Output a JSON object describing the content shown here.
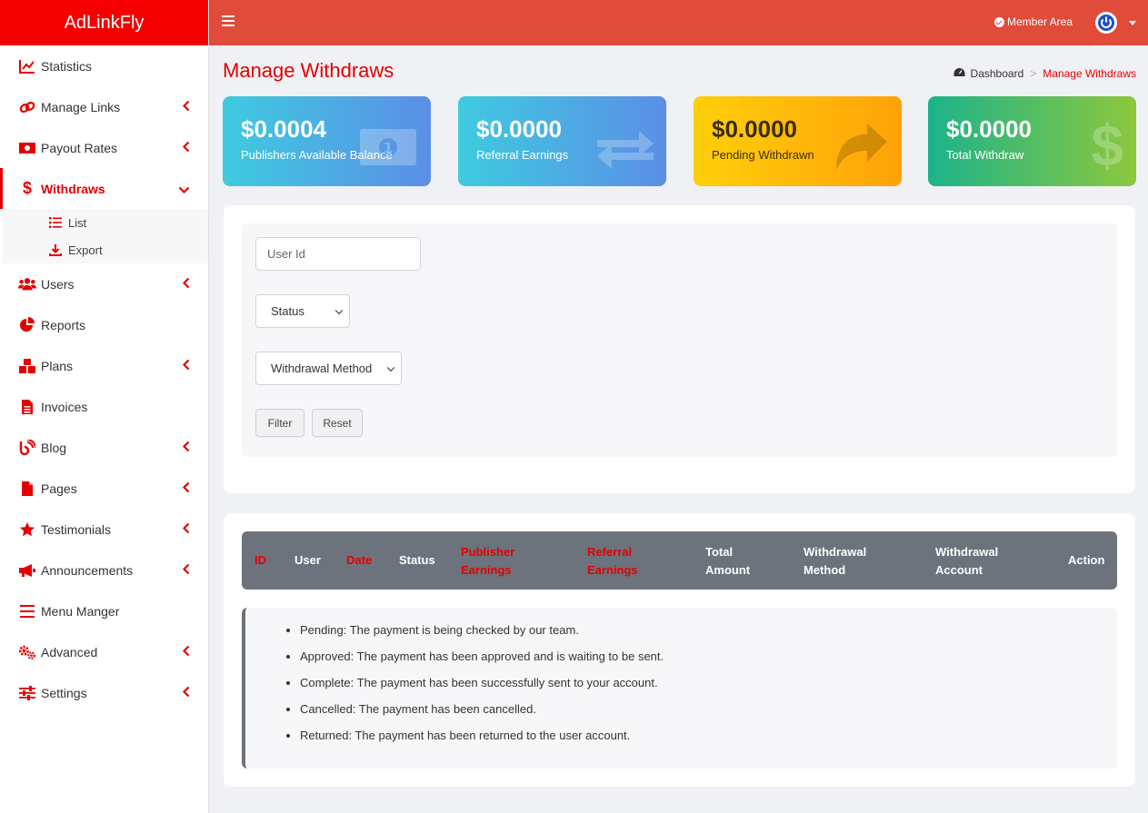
{
  "app": {
    "brand": "AdLinkFly"
  },
  "header": {
    "member_area": "Member Area"
  },
  "sidebar": {
    "items": [
      {
        "label": "Statistics",
        "icon": "chart-line-icon"
      },
      {
        "label": "Manage Links",
        "icon": "link-icon"
      },
      {
        "label": "Payout Rates",
        "icon": "money-bill-icon"
      },
      {
        "label": "Withdraws",
        "icon": "dollar-sign-icon"
      },
      {
        "label": "Users",
        "icon": "users-icon"
      },
      {
        "label": "Reports",
        "icon": "pie-chart-icon"
      },
      {
        "label": "Plans",
        "icon": "cubes-icon"
      },
      {
        "label": "Invoices",
        "icon": "file-invoice-icon"
      },
      {
        "label": "Blog",
        "icon": "blog-icon"
      },
      {
        "label": "Pages",
        "icon": "file-icon"
      },
      {
        "label": "Testimonials",
        "icon": "star-icon"
      },
      {
        "label": "Announcements",
        "icon": "bullhorn-icon"
      },
      {
        "label": "Menu Manger",
        "icon": "bars-icon"
      },
      {
        "label": "Advanced",
        "icon": "cogs-icon"
      },
      {
        "label": "Settings",
        "icon": "sliders-icon"
      }
    ],
    "withdraws_sub": [
      {
        "label": "List",
        "icon": "list-icon"
      },
      {
        "label": "Export",
        "icon": "download-icon"
      }
    ]
  },
  "page": {
    "title": "Manage Withdraws",
    "breadcrumb": {
      "home": "Dashboard",
      "sep": ">",
      "current": "Manage Withdraws"
    }
  },
  "cards": [
    {
      "amount": "$0.0004",
      "label": "Publishers Available Balance",
      "icon": "money-bill-icon"
    },
    {
      "amount": "$0.0000",
      "label": "Referral Earnings",
      "icon": "exchange-icon"
    },
    {
      "amount": "$0.0000",
      "label": "Pending Withdrawn",
      "icon": "share-icon"
    },
    {
      "amount": "$0.0000",
      "label": "Total Withdraw",
      "icon": "dollar-sign-icon"
    }
  ],
  "filter": {
    "user_id_placeholder": "User Id",
    "status_selected": "Status",
    "method_selected": "Withdrawal Method",
    "filter_button": "Filter",
    "reset_button": "Reset"
  },
  "table": {
    "headers": [
      {
        "label": "ID",
        "highlight": true
      },
      {
        "label": "User",
        "highlight": false
      },
      {
        "label": "Date",
        "highlight": true
      },
      {
        "label": "Status",
        "highlight": false
      },
      {
        "label": "Publisher Earnings",
        "line1": "Publisher",
        "line2": "Earnings",
        "highlight": true
      },
      {
        "label": "Referral Earnings",
        "line1": "Referral",
        "line2": "Earnings",
        "highlight": true
      },
      {
        "label": "Total Amount",
        "line1": "Total",
        "line2": "Amount",
        "highlight": false
      },
      {
        "label": "Withdrawal Method",
        "line1": "Withdrawal",
        "line2": "Method",
        "highlight": false
      },
      {
        "label": "Withdrawal Account",
        "line1": "Withdrawal",
        "line2": "Account",
        "highlight": false
      },
      {
        "label": "Action",
        "highlight": false
      }
    ]
  },
  "legend": [
    "Pending: The payment is being checked by our team.",
    "Approved: The payment has been approved and is waiting to be sent.",
    "Complete: The payment has been successfully sent to your account.",
    "Cancelled: The payment has been cancelled.",
    "Returned: The payment has been returned to the user account."
  ],
  "colors": {
    "brand_red": "#f40000",
    "header_red": "#e04b3a",
    "accent_red": "#e30000",
    "table_header": "#6c737c"
  }
}
